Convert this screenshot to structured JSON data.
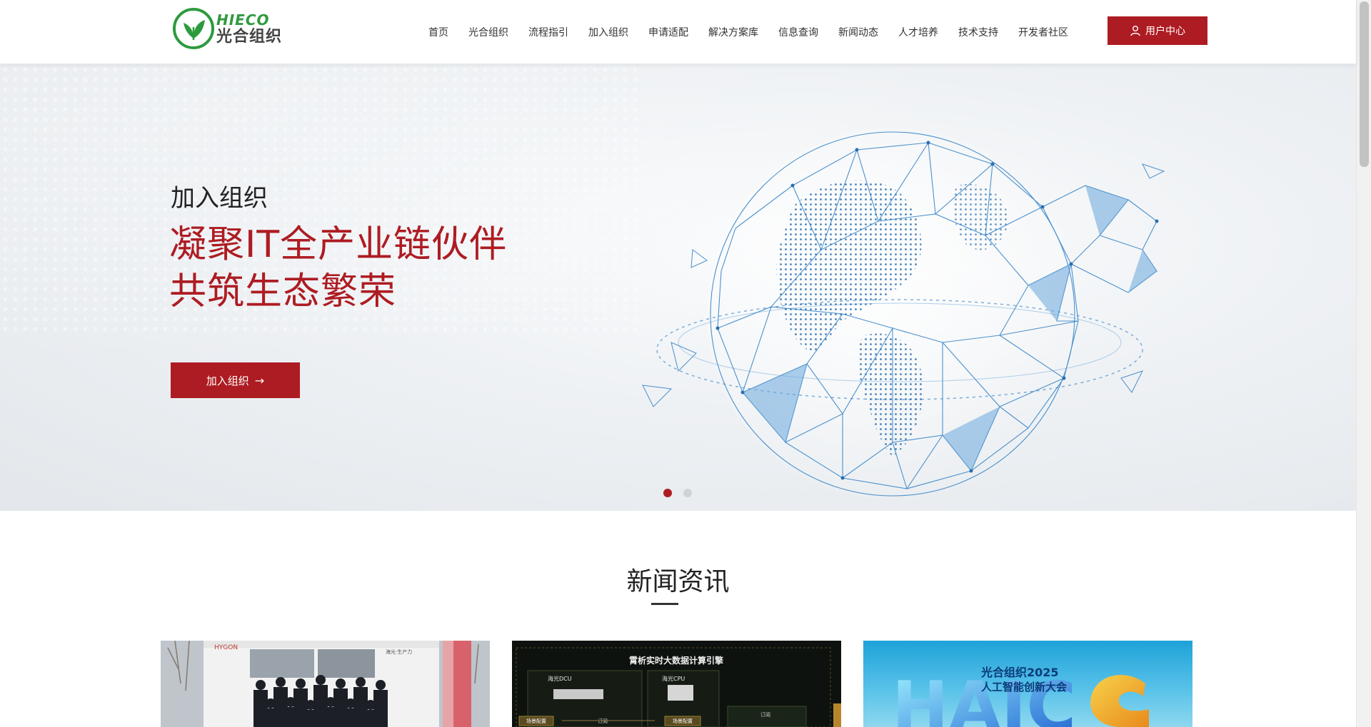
{
  "header": {
    "logo_en": "HIECO",
    "logo_cn": "光合组织",
    "nav": [
      "首页",
      "光合组织",
      "流程指引",
      "加入组织",
      "申请适配",
      "解决方案库",
      "信息查询",
      "新闻动态",
      "人才培养",
      "技术支持",
      "开发者社区"
    ],
    "user_button": "用户中心"
  },
  "hero": {
    "subtitle": "加入组织",
    "title_line1": "凝聚IT全产业链伙伴",
    "title_line2": "共筑生态繁荣",
    "button_label": "加入组织",
    "slide_count": 2,
    "active_slide": 1
  },
  "news": {
    "heading": "新闻资讯",
    "cards": [
      {
        "banner_text": "HYGON",
        "side_text": "海光·生产力"
      },
      {
        "heading": "霄析实时大数据计算引擎",
        "box1": "海光DCU",
        "box2": "海光CPU",
        "tag1": "场景配置",
        "tag2": "订阅",
        "tag3": "场景配置",
        "tag4": "订阅"
      },
      {
        "line1": "光合组织2025",
        "line2": "人工智能创新大会",
        "big_letters": "HAIC"
      }
    ]
  },
  "colors": {
    "brand_red": "#ad1c22",
    "logo_green": "#2e9a3e"
  }
}
